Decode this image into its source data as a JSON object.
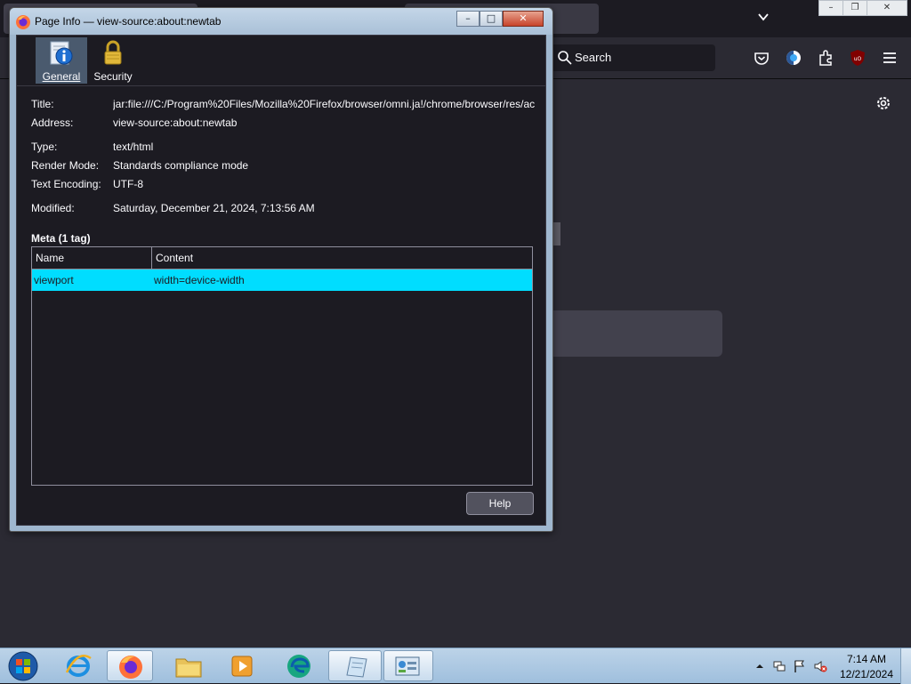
{
  "browser": {
    "toolbar": {
      "search_placeholder": "Search"
    }
  },
  "dialog": {
    "title": "Page Info — view-source:about:newtab",
    "tabs": [
      {
        "label": "General",
        "icon": "info-icon",
        "selected": true
      },
      {
        "label": "Security",
        "icon": "lock-icon",
        "selected": false
      }
    ],
    "fields": {
      "title_label": "Title:",
      "title_value": "jar:file:///C:/Program%20Files/Mozilla%20Firefox/browser/omni.ja!/chrome/browser/res/ac",
      "address_label": "Address:",
      "address_value": "view-source:about:newtab",
      "type_label": "Type:",
      "type_value": "text/html",
      "render_mode_label": "Render Mode:",
      "render_mode_value": "Standards compliance mode",
      "encoding_label": "Text Encoding:",
      "encoding_value": "UTF-8",
      "modified_label": "Modified:",
      "modified_value": "Saturday, December 21, 2024, 7:13:56 AM"
    },
    "meta": {
      "heading": "Meta (1 tag)",
      "columns": [
        "Name",
        "Content"
      ],
      "rows": [
        {
          "name": "viewport",
          "content": "width=device-width"
        }
      ]
    },
    "help_label": "Help"
  },
  "taskbar": {
    "apps": [
      "internet-explorer",
      "firefox",
      "file-explorer",
      "media-player",
      "edge",
      "notepad",
      "control-panel"
    ],
    "clock": {
      "time": "7:14 AM",
      "date": "12/21/2024"
    }
  },
  "colors": {
    "dialog_bg": "#1c1b22",
    "selected_row": "#00ddff",
    "firefox_bg": "#2b2a33"
  }
}
